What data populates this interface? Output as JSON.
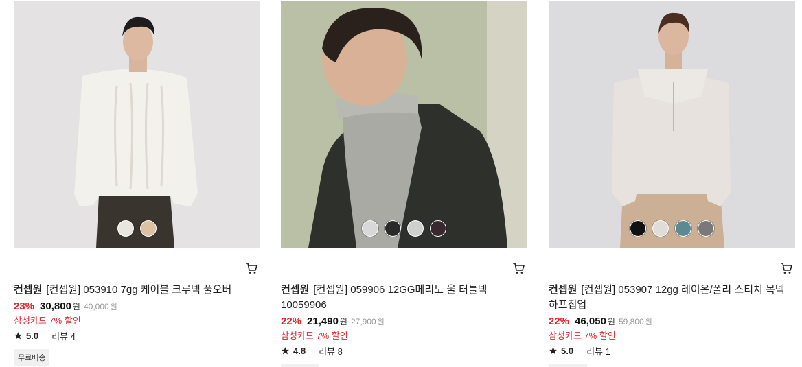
{
  "products": [
    {
      "brand": "컨셉원",
      "name": "[컨셉원] 053910 7gg 케이블 크루넥 풀오버",
      "discount": "23%",
      "price": "30,800",
      "currency": "원",
      "original_price": "40,000",
      "card_promo": "삼성카드 7% 할인",
      "rating": "5.0",
      "review": "리뷰 4",
      "badge": "무료배송",
      "swatch_colors": [
        "#e9e6e0",
        "#dcc2a5"
      ],
      "image_bg": "#e4e2e3"
    },
    {
      "brand": "컨셉원",
      "name": "[컨셉원] 059906 12GG메리노 울 터틀넥 10059906",
      "discount": "22%",
      "price": "21,490",
      "currency": "원",
      "original_price": "27,900",
      "card_promo": "삼성카드 7% 할인",
      "rating": "4.8",
      "review": "리뷰 8",
      "swatch_colors": [
        "#d8d8d8",
        "#2a2a2a",
        "#cfcfcd",
        "#3a2830"
      ],
      "image_bg": "#b9c0a6"
    },
    {
      "brand": "컨셉원",
      "name": "[컨셉원] 053907 12gg 레이온/폴리 스티치 목넥 하프집업",
      "discount": "22%",
      "price": "46,050",
      "currency": "원",
      "original_price": "59,800",
      "card_promo": "삼성카드 7% 할인",
      "rating": "5.0",
      "review": "리뷰 1",
      "swatch_colors": [
        "#111111",
        "#e0dcd8",
        "#5c8a92",
        "#7a7878"
      ],
      "image_bg": "#dcdcde"
    }
  ],
  "icons": {
    "cart": "cart-icon",
    "star": "star-icon"
  },
  "colors": {
    "discount": "#e0242e",
    "badge_bg": "#f0f0f0"
  }
}
